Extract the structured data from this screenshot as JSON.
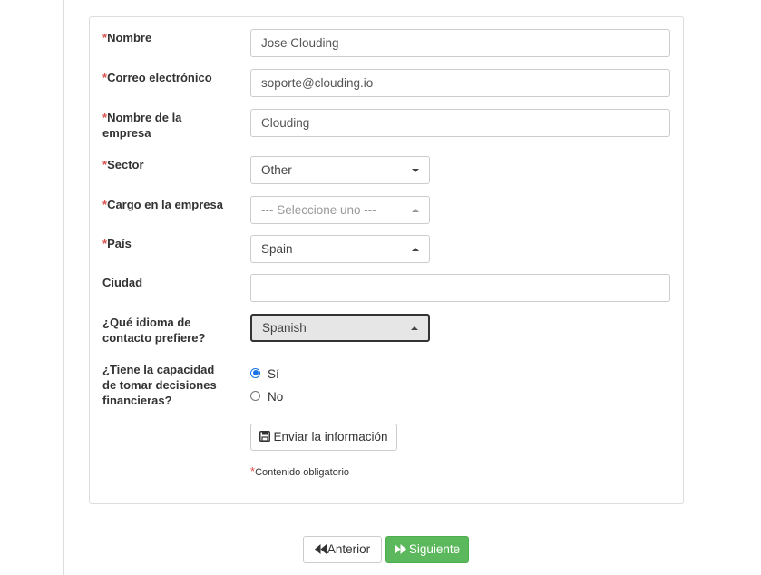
{
  "required_mark": "*",
  "fields": {
    "nombre": {
      "label": "Nombre",
      "value": "Jose Clouding"
    },
    "correo": {
      "label": "Correo electrónico",
      "value": "soporte@clouding.io"
    },
    "empresa": {
      "label": "Nombre de la empresa",
      "value": "Clouding"
    },
    "sector": {
      "label": "Sector",
      "value": "Other"
    },
    "cargo": {
      "label": "Cargo en la empresa",
      "value": "--- Seleccione uno ---"
    },
    "pais": {
      "label": "País",
      "value": "Spain"
    },
    "ciudad": {
      "label": "Ciudad",
      "value": ""
    },
    "idioma": {
      "label": "¿Qué idioma de contacto prefiere?",
      "value": "Spanish"
    },
    "decisiones": {
      "label": "¿Tiene la capacidad de tomar decisiones financieras?",
      "options": [
        {
          "label": "Sí",
          "checked": true
        },
        {
          "label": "No",
          "checked": false
        }
      ]
    }
  },
  "submit_label": "Enviar la información",
  "required_note": "Contenido obligatorio",
  "nav": {
    "prev_label": "Anterior",
    "next_label": "Siguiente"
  },
  "colors": {
    "required": "#d9534f",
    "success": "#5cb85c",
    "radio": "#1a73e8"
  }
}
